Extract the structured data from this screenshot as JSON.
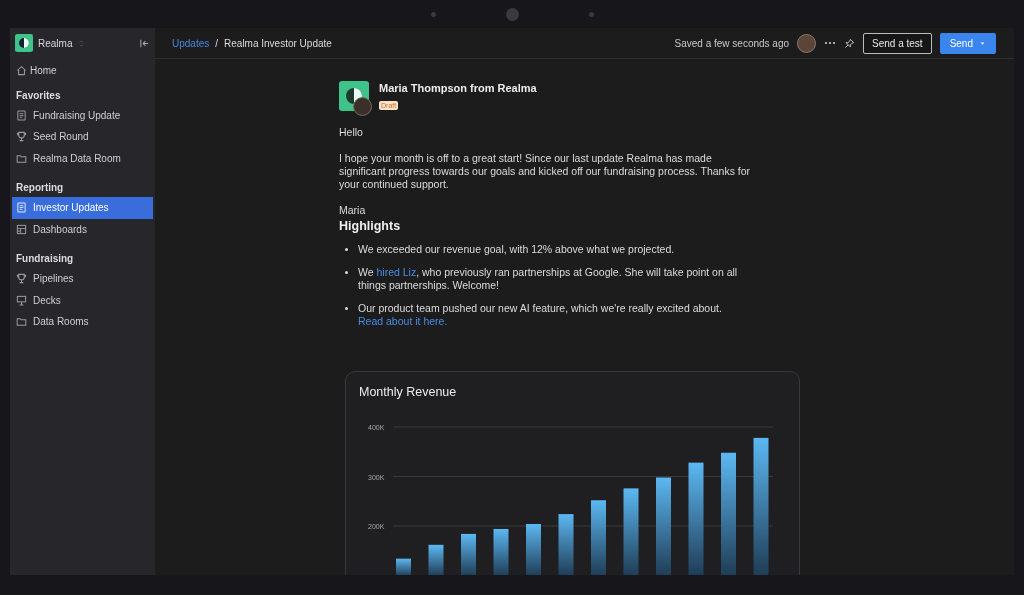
{
  "sidebar": {
    "workspace": "Realma",
    "home": {
      "label": "Home",
      "selected": false
    },
    "sections": [
      {
        "heading": "Favorites",
        "items": [
          {
            "kind": "document",
            "label": "Fundraising Update",
            "selected": false
          },
          {
            "kind": "trophy",
            "label": "Seed Round",
            "selected": false
          },
          {
            "kind": "folder",
            "label": "Realma Data Room",
            "selected": false
          }
        ]
      },
      {
        "heading": "Reporting",
        "items": [
          {
            "kind": "document",
            "label": "Investor Updates",
            "selected": true
          },
          {
            "kind": "grid",
            "label": "Dashboards",
            "selected": false
          }
        ]
      },
      {
        "heading": "Fundraising",
        "items": [
          {
            "kind": "trophy",
            "label": "Pipelines",
            "selected": false
          },
          {
            "kind": "easel",
            "label": "Decks",
            "selected": false
          },
          {
            "kind": "folder",
            "label": "Data Rooms",
            "selected": false
          }
        ]
      }
    ]
  },
  "topbar": {
    "breadcrumb": [
      {
        "kind": "link",
        "label": "Updates"
      },
      {
        "kind": "separator",
        "label": "/"
      },
      {
        "kind": "current",
        "label": "Realma Investor Update"
      }
    ],
    "save_status": "Saved a few seconds ago",
    "buttons": [
      {
        "kind": "outline",
        "label": "Send a test"
      },
      {
        "kind": "split",
        "label": "Send"
      }
    ]
  },
  "letter": {
    "sender": "Maria Thompson from Realma",
    "badge": "Draft",
    "greeting": "Hello",
    "paragraph": "I hope your month is off to a great start! Since our last update Realma has made significant progress towards our goals and kicked off our fundraising process. Thanks for your continued support.",
    "signature": "Maria",
    "heading": "Highlights",
    "bullets": [
      [
        {
          "text": "We exceeded our revenue goal, with 12% above what we projected."
        }
      ],
      [
        {
          "text": "We "
        },
        {
          "text": "hired Liz",
          "link": true
        },
        {
          "text": ", who previously ran partnerships at Google. She will take point on all things partnerships. Welcome!"
        }
      ],
      [
        {
          "text": "Our product team pushed our new AI feature, which we're really excited about. "
        },
        {
          "text": "Read about it here.",
          "link": true
        }
      ]
    ],
    "chart_data": {
      "type": "bar",
      "title": "Monthly Revenue",
      "values": [
        134000,
        162000,
        184000,
        194000,
        204000,
        224000,
        252000,
        276000,
        298000,
        328000,
        348000,
        378000
      ],
      "ylim": [
        100000,
        400000
      ],
      "yticks": [
        {
          "value": 200000,
          "label": "200K"
        },
        {
          "value": 300000,
          "label": "300K"
        },
        {
          "value": 400000,
          "label": "400K"
        }
      ]
    }
  }
}
